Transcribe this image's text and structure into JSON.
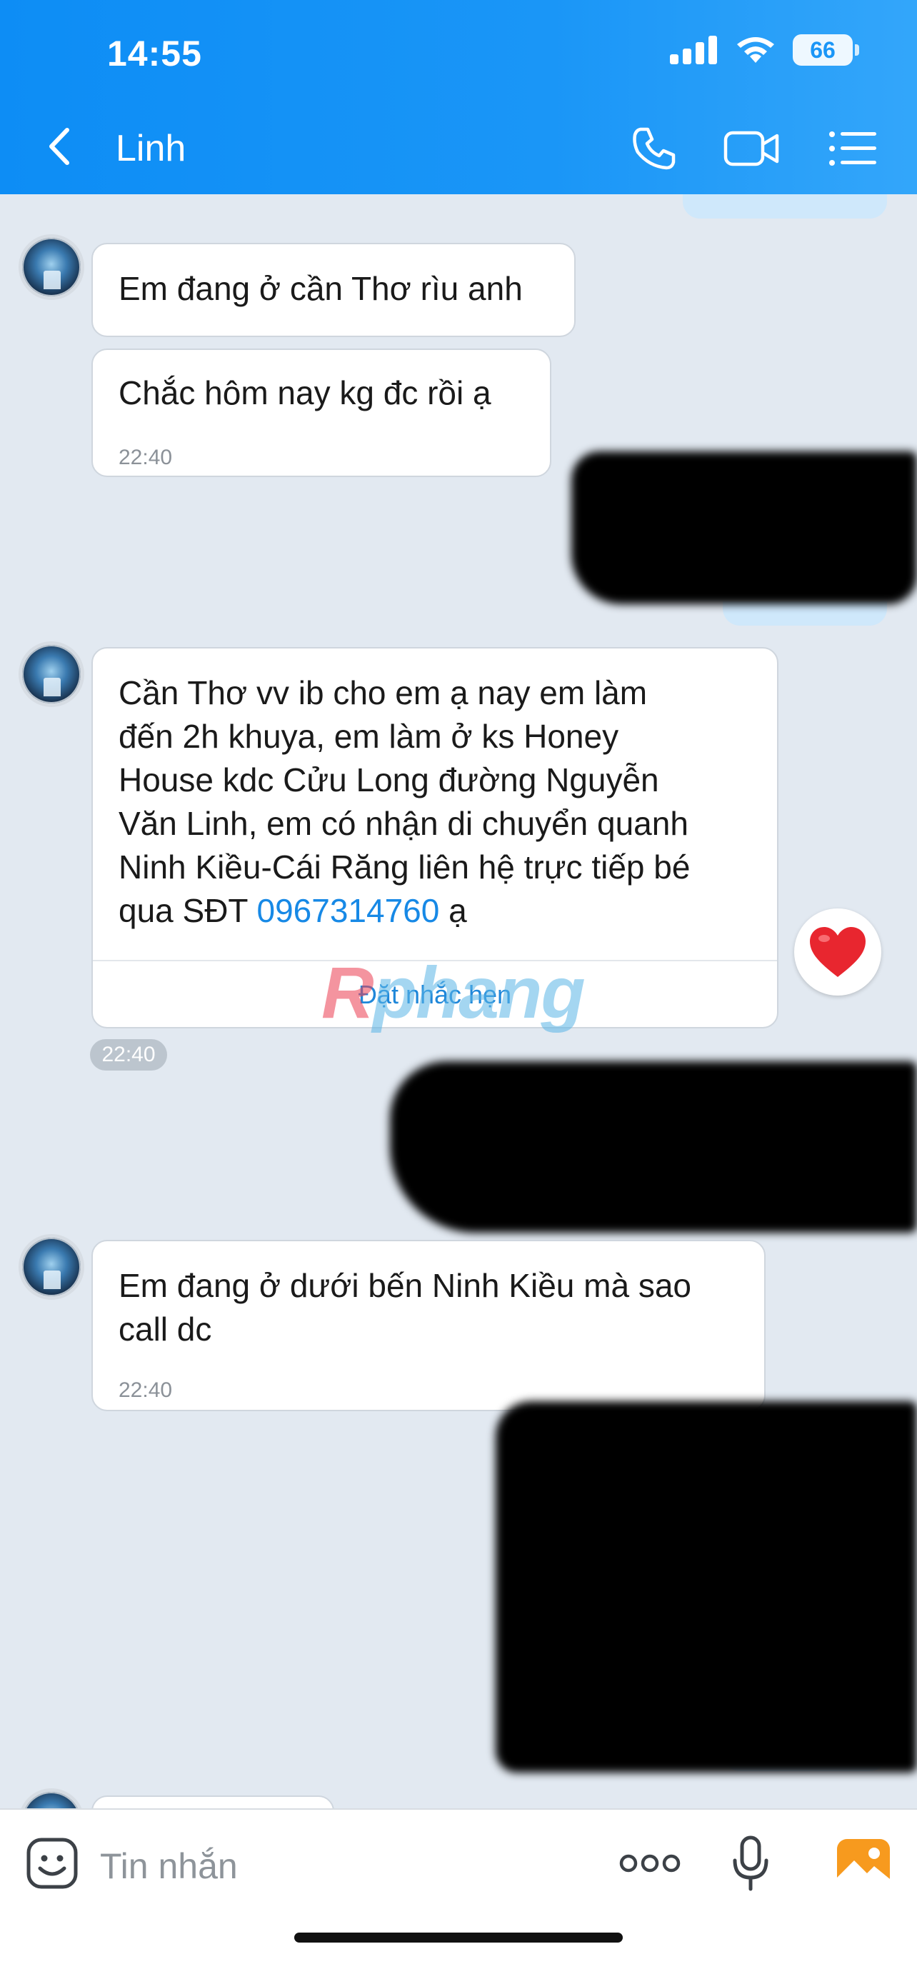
{
  "status_bar": {
    "time": "14:55",
    "battery": "66"
  },
  "header": {
    "title": "Linh"
  },
  "messages": [
    {
      "text": "Em đang ở cần Thơ rìu anh"
    },
    {
      "text": "Chắc hôm nay kg đc rồi ạ",
      "time": "22:40"
    },
    {
      "text_lines": [
        "Cần Thơ vv ib cho em ạ nay em làm",
        "đến 2h khuya, em làm ở ks Honey",
        "House kdc Cửu Long đường Nguyễn",
        "Văn Linh, em có nhận di chuyển quanh",
        "Ninh Kiều-Cái Răng liên hệ trực tiếp bé"
      ],
      "last_line_prefix": "qua SĐT ",
      "phone": "0967314760",
      "last_line_suffix": " ạ",
      "action": "Đặt nhắc hẹn",
      "time": "22:40",
      "reaction": "heart"
    },
    {
      "text_lines": [
        "Em đang ở dưới bến Ninh Kiều mà sao",
        "call dc"
      ],
      "time": "22:40"
    }
  ],
  "watermark": {
    "prefix": "R",
    "rest": "phang"
  },
  "composer": {
    "placeholder": "Tin nhắn"
  },
  "colors": {
    "header": "#1a96f7",
    "chat_bg": "#e2e9f1",
    "link": "#1789e6",
    "reaction": "#e8262f"
  },
  "icons": [
    "back-chevron-icon",
    "phone-icon",
    "video-camera-icon",
    "menu-list-icon",
    "sticker-icon",
    "more-icon",
    "microphone-icon",
    "image-icon"
  ]
}
